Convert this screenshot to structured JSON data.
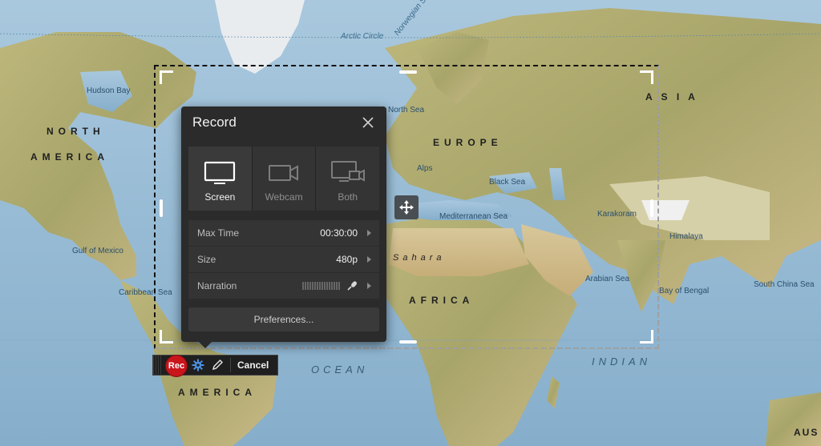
{
  "map": {
    "labels": {
      "arctic_circle": "Arctic Circle",
      "norwegian_sea": "Norwegian Sea",
      "hudson_bay": "Hudson Bay",
      "north": "NORTH",
      "america_n": "AMERICA",
      "north_sea": "North Sea",
      "europe": "EUROPE",
      "asia": "A S I A",
      "black_sea": "Black Sea",
      "mediterranean": "Mediterranean Sea",
      "sahara": "Sahara",
      "africa": "AFRICA",
      "gulf_of_mexico": "Gulf of Mexico",
      "caribbean_sea": "Caribbean Sea",
      "arabian_sea": "Arabian Sea",
      "bay_of_bengal": "Bay of Bengal",
      "south_china_sea": "South China Sea",
      "himalaya": "Himalaya",
      "karakoram": "Karakoram",
      "ocean": "OCEAN",
      "indian": "INDIAN",
      "america_s": "AMERICA",
      "alps": "Alps",
      "aus": "AUS"
    }
  },
  "dialog": {
    "title": "Record",
    "sources": [
      {
        "label": "Screen",
        "icon": "screen-icon",
        "active": true
      },
      {
        "label": "Webcam",
        "icon": "webcam-icon",
        "active": false
      },
      {
        "label": "Both",
        "icon": "both-icon",
        "active": false
      }
    ],
    "settings": {
      "max_time": {
        "label": "Max Time",
        "value": "00:30:00"
      },
      "size": {
        "label": "Size",
        "value": "480p"
      },
      "narration": {
        "label": "Narration"
      }
    },
    "preferences_label": "Preferences..."
  },
  "toolbar": {
    "rec_label": "Rec",
    "cancel_label": "Cancel"
  },
  "colors": {
    "water": "#8fb6d3",
    "land": "#b6b27a",
    "dialog_bg": "#2b2b2b",
    "rec_red": "#c8161b",
    "gear_blue": "#4a8fe0"
  }
}
